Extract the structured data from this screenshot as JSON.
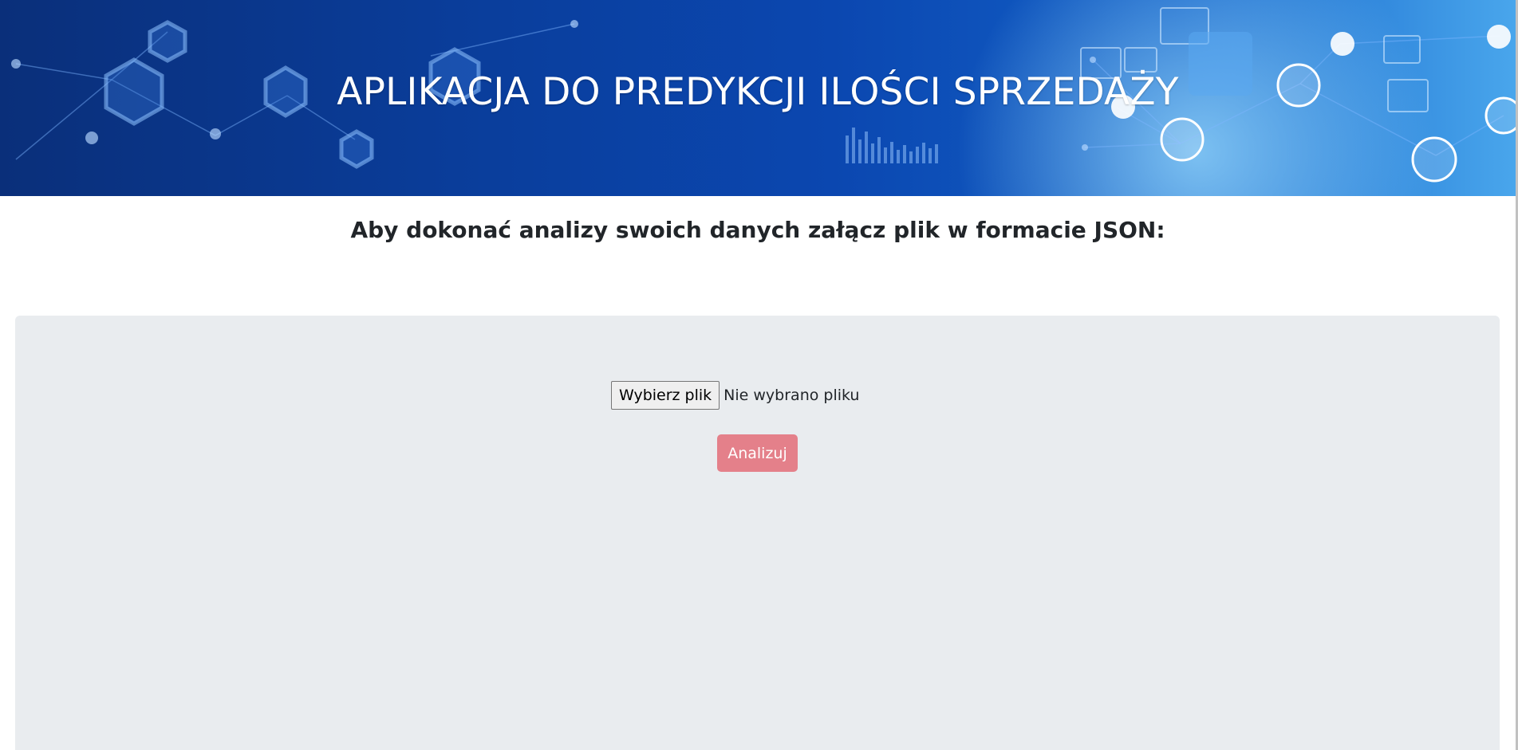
{
  "header": {
    "title": "APLIKACJA DO PREDYKCJI ILOŚCI SPRZEDAŻY"
  },
  "main": {
    "instruction": "Aby dokonać analizy swoich danych załącz plik w formacie JSON:",
    "file_input": {
      "button_label": "Wybierz plik",
      "status_text": "Nie wybrano pliku"
    },
    "analyze_button_label": "Analizuj"
  },
  "colors": {
    "banner_dark": "#0a2f7a",
    "banner_light": "#49a6ec",
    "panel_background": "#e9ecef",
    "analyze_button": "#e4808a"
  }
}
